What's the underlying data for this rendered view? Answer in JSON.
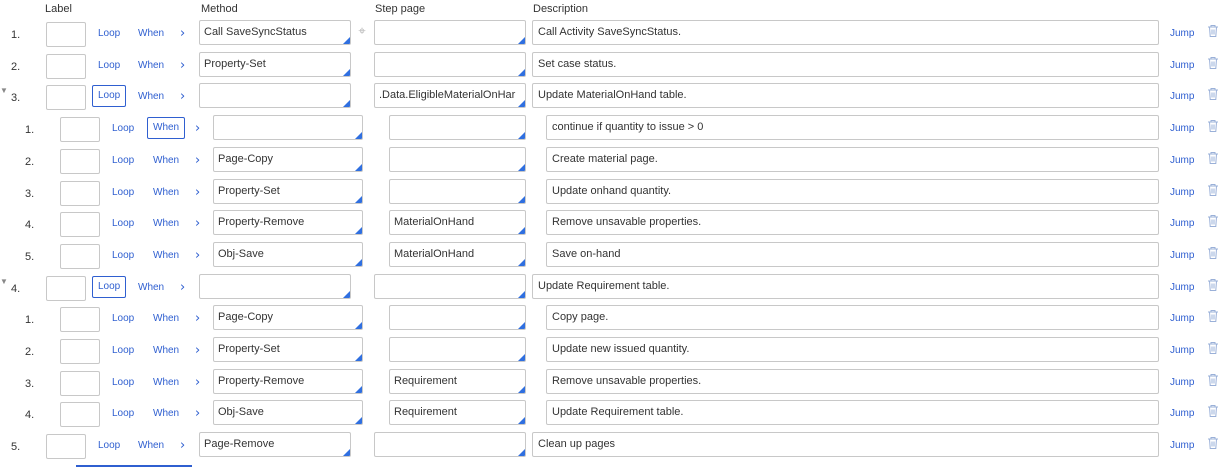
{
  "headers": {
    "label": "Label",
    "method": "Method",
    "step_page": "Step page",
    "description": "Description"
  },
  "link_labels": {
    "loop": "Loop",
    "when": "When",
    "jump": "Jump"
  },
  "icons": {
    "expand": "triangle-down-icon",
    "chevron": "chevron-right-icon",
    "params": "crosshair-icon",
    "delete": "trash-icon",
    "dropdown": "dropdown-corner-icon"
  },
  "accent_color": "#2f5fd0",
  "steps": [
    {
      "num": "1.",
      "label": "",
      "method": "Call SaveSyncStatus",
      "step_page": "",
      "description": "Call Activity SaveSyncStatus.",
      "indent": false,
      "expandable": false,
      "loop_active": false,
      "when_active": false,
      "param_icon": true
    },
    {
      "num": "2.",
      "label": "",
      "method": "Property-Set",
      "step_page": "",
      "description": "Set case status.",
      "indent": false,
      "expandable": false,
      "loop_active": false,
      "when_active": false,
      "param_icon": false
    },
    {
      "num": "3.",
      "label": "",
      "method": "",
      "step_page": ".Data.EligibleMaterialOnHar",
      "description": "Update MaterialOnHand table.",
      "indent": false,
      "expandable": true,
      "loop_active": true,
      "when_active": false,
      "param_icon": false
    },
    {
      "num": "1.",
      "label": "",
      "method": "",
      "step_page": "",
      "description": "continue if quantity to issue > 0",
      "indent": true,
      "expandable": false,
      "loop_active": false,
      "when_active": true,
      "param_icon": false
    },
    {
      "num": "2.",
      "label": "",
      "method": "Page-Copy",
      "step_page": "",
      "description": "Create material page.",
      "indent": true,
      "expandable": false,
      "loop_active": false,
      "when_active": false,
      "param_icon": false
    },
    {
      "num": "3.",
      "label": "",
      "method": "Property-Set",
      "step_page": "",
      "description": "Update onhand quantity.",
      "indent": true,
      "expandable": false,
      "loop_active": false,
      "when_active": false,
      "param_icon": false
    },
    {
      "num": "4.",
      "label": "",
      "method": "Property-Remove",
      "step_page": "MaterialOnHand",
      "description": "Remove unsavable properties.",
      "indent": true,
      "expandable": false,
      "loop_active": false,
      "when_active": false,
      "param_icon": false
    },
    {
      "num": "5.",
      "label": "",
      "method": "Obj-Save",
      "step_page": "MaterialOnHand",
      "description": "Save on-hand",
      "indent": true,
      "expandable": false,
      "loop_active": false,
      "when_active": false,
      "param_icon": false
    },
    {
      "num": "4.",
      "label": "",
      "method": "",
      "step_page": "",
      "description": "Update Requirement table.",
      "indent": false,
      "expandable": true,
      "loop_active": true,
      "when_active": false,
      "param_icon": false
    },
    {
      "num": "1.",
      "label": "",
      "method": "Page-Copy",
      "step_page": "",
      "description": "Copy page.",
      "indent": true,
      "expandable": false,
      "loop_active": false,
      "when_active": false,
      "param_icon": false
    },
    {
      "num": "2.",
      "label": "",
      "method": "Property-Set",
      "step_page": "",
      "description": "Update new issued quantity.",
      "indent": true,
      "expandable": false,
      "loop_active": false,
      "when_active": false,
      "param_icon": false
    },
    {
      "num": "3.",
      "label": "",
      "method": "Property-Remove",
      "step_page": "Requirement",
      "description": "Remove unsavable properties.",
      "indent": true,
      "expandable": false,
      "loop_active": false,
      "when_active": false,
      "param_icon": false
    },
    {
      "num": "4.",
      "label": "",
      "method": "Obj-Save",
      "step_page": "Requirement",
      "description": "Update Requirement table.",
      "indent": true,
      "expandable": false,
      "loop_active": false,
      "when_active": false,
      "param_icon": false
    },
    {
      "num": "5.",
      "label": "",
      "method": "Page-Remove",
      "step_page": "",
      "description": "Clean up pages",
      "indent": false,
      "expandable": false,
      "loop_active": false,
      "when_active": false,
      "param_icon": false
    }
  ]
}
